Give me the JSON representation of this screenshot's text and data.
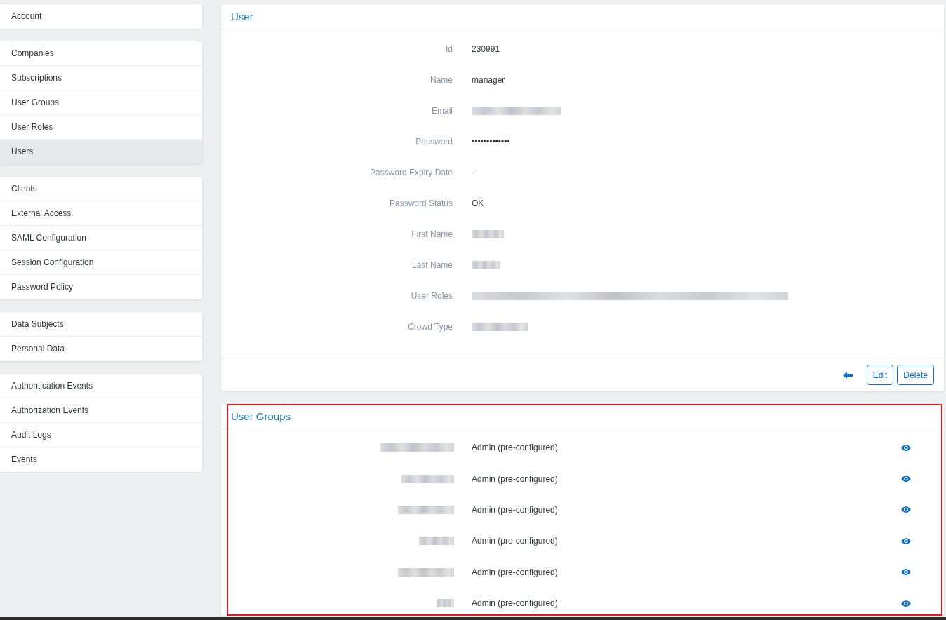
{
  "sidebar": {
    "groups": [
      {
        "items": [
          {
            "label": "Account",
            "selected": false
          }
        ]
      },
      {
        "items": [
          {
            "label": "Companies",
            "selected": false
          },
          {
            "label": "Subscriptions",
            "selected": false
          },
          {
            "label": "User Groups",
            "selected": false
          },
          {
            "label": "User Roles",
            "selected": false
          },
          {
            "label": "Users",
            "selected": true
          }
        ]
      },
      {
        "items": [
          {
            "label": "Clients",
            "selected": false
          },
          {
            "label": "External Access",
            "selected": false
          },
          {
            "label": "SAML Configuration",
            "selected": false
          },
          {
            "label": "Session Configuration",
            "selected": false
          },
          {
            "label": "Password Policy",
            "selected": false
          }
        ]
      },
      {
        "items": [
          {
            "label": "Data Subjects",
            "selected": false
          },
          {
            "label": "Personal Data",
            "selected": false
          }
        ]
      },
      {
        "items": [
          {
            "label": "Authentication Events",
            "selected": false
          },
          {
            "label": "Authorization Events",
            "selected": false
          },
          {
            "label": "Audit Logs",
            "selected": false
          },
          {
            "label": "Events",
            "selected": false
          }
        ]
      }
    ]
  },
  "user": {
    "title": "User",
    "fields": [
      {
        "label": "Id",
        "value": "230991",
        "redacted": false
      },
      {
        "label": "Name",
        "value": "manager",
        "redacted": false
      },
      {
        "label": "Email",
        "redacted": true
      },
      {
        "label": "Password",
        "value": "•••••••••••••",
        "redacted": false
      },
      {
        "label": "Password Expiry Date",
        "value": "-",
        "redacted": false
      },
      {
        "label": "Password Status",
        "value": "OK",
        "redacted": false
      },
      {
        "label": "First Name",
        "redacted": true
      },
      {
        "label": "Last Name",
        "redacted": true
      },
      {
        "label": "User Roles",
        "redacted": true
      },
      {
        "label": "Crowd Type",
        "redacted": true
      }
    ],
    "buttons": [
      "Edit",
      "Delete"
    ]
  },
  "user_groups": {
    "title": "User Groups",
    "highlighted": true,
    "rows": [
      {
        "name_redacted": true,
        "role": "Admin (pre-configured)"
      },
      {
        "name_redacted": true,
        "role": "Admin (pre-configured)"
      },
      {
        "name_redacted": true,
        "role": "Admin (pre-configured)"
      },
      {
        "name_redacted": true,
        "role": "Admin (pre-configured)"
      },
      {
        "name_redacted": true,
        "role": "Admin (pre-configured)"
      },
      {
        "name_redacted": true,
        "role": "Admin (pre-configured)"
      }
    ]
  }
}
